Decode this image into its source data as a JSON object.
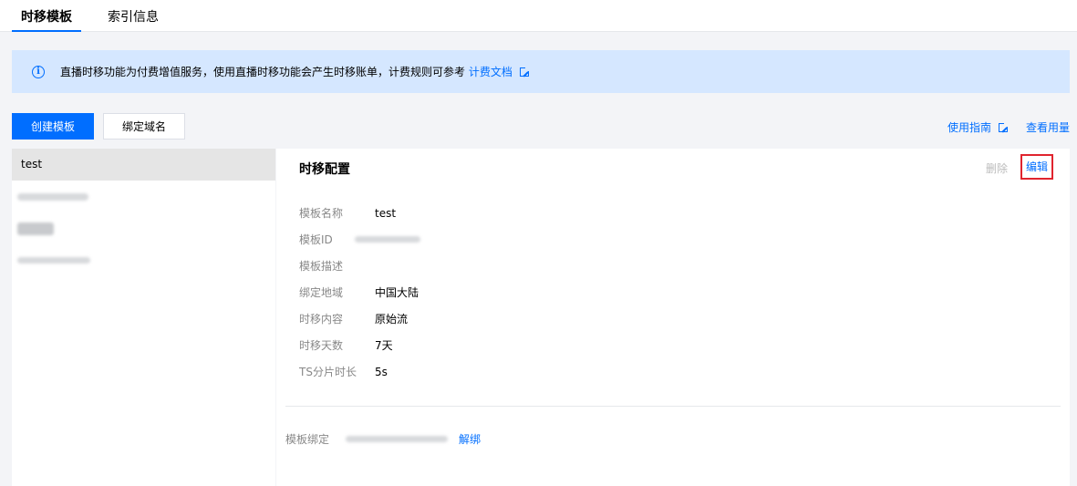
{
  "tabs": [
    {
      "label": "时移模板"
    },
    {
      "label": "索引信息"
    }
  ],
  "notice": {
    "text": "直播时移功能为付费增值服务，使用直播时移功能会产生时移账单，计费规则可参考",
    "link": "计费文档"
  },
  "toolbar": {
    "create_label": "创建模板",
    "bind_label": "绑定域名",
    "guide_link": "使用指南",
    "usage_link": "查看用量"
  },
  "template_list": [
    {
      "name": "test"
    }
  ],
  "detail": {
    "title": "时移配置",
    "delete_label": "删除",
    "edit_label": "编辑",
    "fields": [
      {
        "label": "模板名称",
        "value": "test"
      },
      {
        "label": "模板ID",
        "value": ""
      },
      {
        "label": "模板描述",
        "value": ""
      },
      {
        "label": "绑定地域",
        "value": "中国大陆"
      },
      {
        "label": "时移内容",
        "value": "原始流"
      },
      {
        "label": "时移天数",
        "value": "7天"
      },
      {
        "label": "TS分片时长",
        "value": "5s"
      }
    ],
    "binding_label": "模板绑定",
    "unbind_label": "解绑"
  },
  "colors": {
    "accent": "#006eff",
    "notice_bg": "#d5e7ff",
    "highlight": "#e0242e"
  }
}
